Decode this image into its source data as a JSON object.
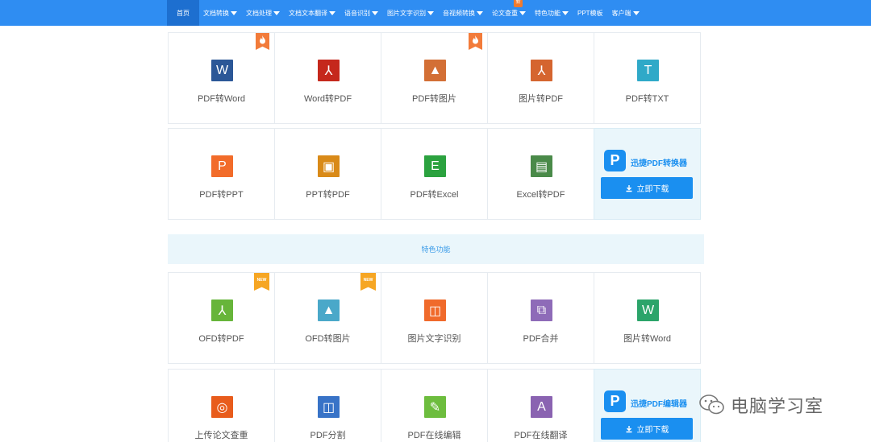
{
  "nav": {
    "items": [
      {
        "label": "首页",
        "caret": false
      },
      {
        "label": "文档转换",
        "caret": true
      },
      {
        "label": "文档处理",
        "caret": true
      },
      {
        "label": "文档文本翻译",
        "caret": true
      },
      {
        "label": "语音识别",
        "caret": true
      },
      {
        "label": "图片文字识别",
        "caret": true
      },
      {
        "label": "音视频转换",
        "caret": true
      },
      {
        "label": "论文查重",
        "caret": true,
        "badge": "新"
      },
      {
        "label": "特色功能",
        "caret": true
      },
      {
        "label": "PPT模板",
        "caret": false
      },
      {
        "label": "客户端",
        "caret": true
      }
    ],
    "active_index": 0,
    "color": "#2f8df2"
  },
  "row1": [
    {
      "label": "PDF转Word",
      "icon": "word-doc-icon",
      "glyph": "W",
      "color": "#2b5797",
      "hot": true
    },
    {
      "label": "Word转PDF",
      "icon": "pdf-doc-icon",
      "glyph": "⅄",
      "color": "#c5281c",
      "hot": false
    },
    {
      "label": "PDF转图片",
      "icon": "image-doc-icon",
      "glyph": "▲",
      "color": "#d36f35",
      "hot": true
    },
    {
      "label": "图片转PDF",
      "icon": "pdf-doc-icon",
      "glyph": "⅄",
      "color": "#d5652f",
      "hot": false
    },
    {
      "label": "PDF转TXT",
      "icon": "txt-doc-icon",
      "glyph": "T",
      "color": "#2fa9c8",
      "hot": false
    }
  ],
  "row2": [
    {
      "label": "PDF转PPT",
      "icon": "ppt-doc-icon",
      "glyph": "P",
      "color": "#f26c2a"
    },
    {
      "label": "PPT转PDF",
      "icon": "ppt-pdf-icon",
      "glyph": "▣",
      "color": "#d98a18"
    },
    {
      "label": "PDF转Excel",
      "icon": "excel-doc-icon",
      "glyph": "E",
      "color": "#2ba23f"
    },
    {
      "label": "Excel转PDF",
      "icon": "excel-pdf-icon",
      "glyph": "▤",
      "color": "#4a8a49"
    }
  ],
  "promo1": {
    "brand": "迅捷PDF转换器",
    "download": "立即下载"
  },
  "band": {
    "title": "特色功能"
  },
  "row3": [
    {
      "label": "OFD转PDF",
      "icon": "ofd-pdf-icon",
      "glyph": "⅄",
      "color": "#67b53a",
      "new": true
    },
    {
      "label": "OFD转图片",
      "icon": "ofd-image-icon",
      "glyph": "▲",
      "color": "#4aa8c9",
      "new": true
    },
    {
      "label": "图片文字识别",
      "icon": "ocr-icon",
      "glyph": "◫",
      "color": "#f06a2b",
      "new": false
    },
    {
      "label": "PDF合并",
      "icon": "merge-icon",
      "glyph": "⧉",
      "color": "#8e6bb8",
      "new": false
    },
    {
      "label": "图片转Word",
      "icon": "image-word-icon",
      "glyph": "W",
      "color": "#2ba46a",
      "new": false
    }
  ],
  "row4": [
    {
      "label": "上传论文查重",
      "icon": "paper-check-icon",
      "glyph": "◎",
      "color": "#e85c1c"
    },
    {
      "label": "PDF分割",
      "icon": "split-icon",
      "glyph": "◫",
      "color": "#3873c7"
    },
    {
      "label": "PDF在线编辑",
      "icon": "edit-icon",
      "glyph": "✎",
      "color": "#6dbd3e"
    },
    {
      "label": "PDF在线翻译",
      "icon": "translate-icon",
      "glyph": "A",
      "color": "#8a63b1"
    }
  ],
  "promo2": {
    "brand": "迅捷PDF编辑器",
    "download": "立即下载"
  },
  "ribbons": {
    "new_label": "NEW"
  },
  "watermark": {
    "text": "电脑学习室"
  }
}
